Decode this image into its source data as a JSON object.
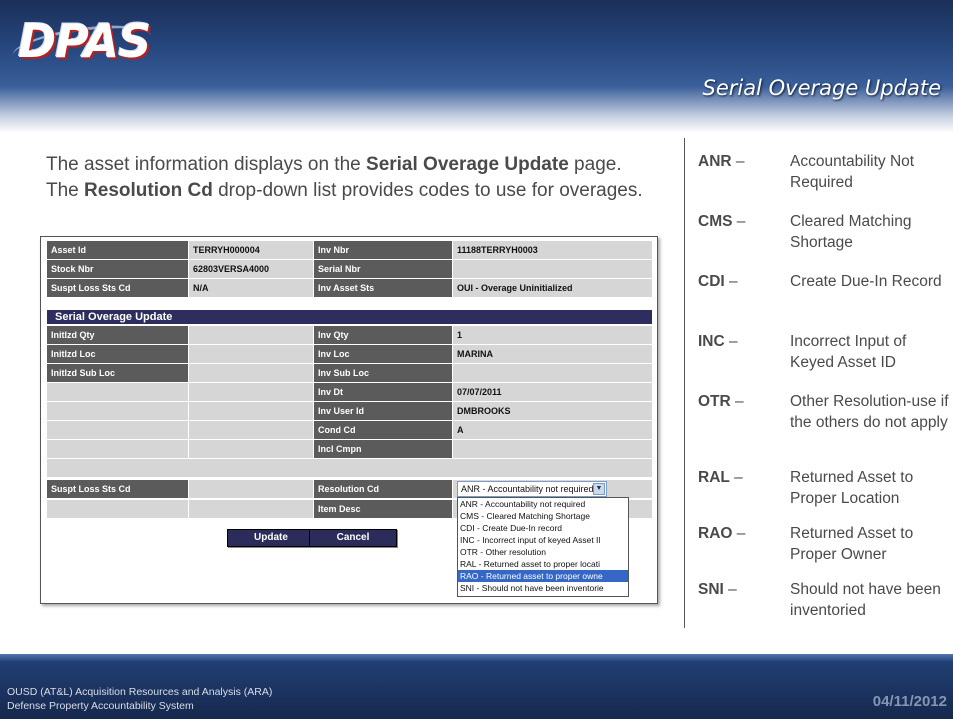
{
  "header": {
    "logo_text": "DPAS",
    "page_heading": "Serial Overage Update"
  },
  "intro": {
    "part1": "The asset information displays on the ",
    "bold1": "Serial Overage Update",
    "part2": " page. The ",
    "bold2": "Resolution Cd",
    "part3": " drop-down list provides codes to use for overages."
  },
  "form": {
    "top_rows": [
      {
        "label1": "Asset Id",
        "value1": "TERRYH000004",
        "label2": "Inv Nbr",
        "value2": "11188TERRYH0003"
      },
      {
        "label1": "Stock Nbr",
        "value1": "62803VERSA4000",
        "label2": "Serial Nbr",
        "value2": ""
      },
      {
        "label1": "Suspt Loss Sts Cd",
        "value1": "N/A",
        "label2": "Inv Asset Sts",
        "value2": "OUI - Overage Uninitialized"
      }
    ],
    "section_title": "Serial Overage Update",
    "detail_rows": [
      {
        "label1": "Initlzd Qty",
        "value1": "",
        "label2": "Inv Qty",
        "value2": "1"
      },
      {
        "label1": "Initlzd Loc",
        "value1": "",
        "label2": "Inv Loc",
        "value2": "MARINA"
      },
      {
        "label1": "Initlzd Sub Loc",
        "value1": "",
        "label2": "Inv Sub Loc",
        "value2": ""
      },
      {
        "label1": "",
        "value1": "",
        "label2": "Inv Dt",
        "value2": "07/07/2011"
      },
      {
        "label1": "",
        "value1": "",
        "label2": "Inv User Id",
        "value2": "DMBROOKS"
      },
      {
        "label1": "",
        "value1": "",
        "label2": "Cond Cd",
        "value2": "A"
      },
      {
        "label1": "",
        "value1": "",
        "label2": "Incl Cmpn",
        "value2": ""
      },
      {
        "label1": "Suspt Loss Sts Cd",
        "value1": "",
        "label2": "Resolution Cd",
        "value2": ""
      },
      {
        "label1": "",
        "value1": "",
        "label2": "Item Desc",
        "value2": ""
      }
    ],
    "resolution_select_value": "ANR - Accountability not required",
    "dropdown_options": [
      "ANR - Accountability not required",
      "CMS - Cleared Matching Shortage",
      "CDI - Create Due-In record",
      "INC - Incorrect input of keyed Asset Il",
      "OTR - Other resolution",
      "RAL - Returned asset to proper locati",
      "RAO - Returned asset to proper owne",
      "SNI - Should not have been inventorie"
    ],
    "highlighted_option_index": 6,
    "update_label": "Update",
    "cancel_label": "Cancel"
  },
  "codes": [
    {
      "code": "ANR",
      "dash": " –",
      "desc": "Accountability Not Required"
    },
    {
      "code": "CMS",
      "dash": " –",
      "desc": "Cleared Matching Shortage"
    },
    {
      "code": "CDI",
      "dash": " –",
      "desc": "Create Due-In Record"
    },
    {
      "code": "INC",
      "dash": " –",
      "desc": "Incorrect Input of Keyed Asset ID"
    },
    {
      "code": "OTR",
      "dash": " –",
      "desc": "Other Resolution-use if the others do not apply"
    },
    {
      "code": "RAL",
      "dash": " –",
      "desc": "Returned Asset to Proper Location"
    },
    {
      "code": "RAO",
      "dash": " –",
      "desc": "Returned Asset to Proper Owner"
    },
    {
      "code": "SNI",
      "dash": " –",
      "desc": "Should not have been inventoried"
    }
  ],
  "footer": {
    "line1": "OUSD (AT&L) Acquisition Resources and Analysis (ARA)",
    "line2": "Defense Property Accountability System",
    "date": "04/11/2012"
  }
}
